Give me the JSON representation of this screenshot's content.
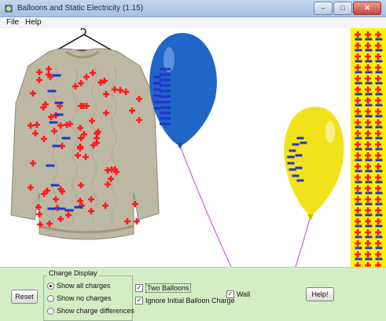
{
  "window": {
    "title": "Balloons and Static Electricity (1.15)"
  },
  "menubar": {
    "items": [
      "File",
      "Help"
    ]
  },
  "controls": {
    "reset_label": "Reset",
    "help_label": "Help!",
    "charge_display": {
      "title": "Charge Display",
      "options": [
        "Show all charges",
        "Show no charges",
        "Show charge differences"
      ],
      "selected": "Show all charges"
    },
    "two_balloons_label": "Two Balloons",
    "two_balloons_checked": true,
    "ignore_initial_label": "Ignore Initial Balloon Charge",
    "ignore_initial_checked": true,
    "wall_label": "Wall",
    "wall_checked": true
  },
  "colors": {
    "sweater": "#bdb8a3",
    "blue_balloon": "#1f66c7",
    "yellow_balloon": "#f2e21a",
    "wall": "#fff200",
    "positive_charge": "#ff1a1a",
    "negative_charge": "#2233cc",
    "string": "#d46ad4",
    "control_panel": "#d3eec5"
  }
}
